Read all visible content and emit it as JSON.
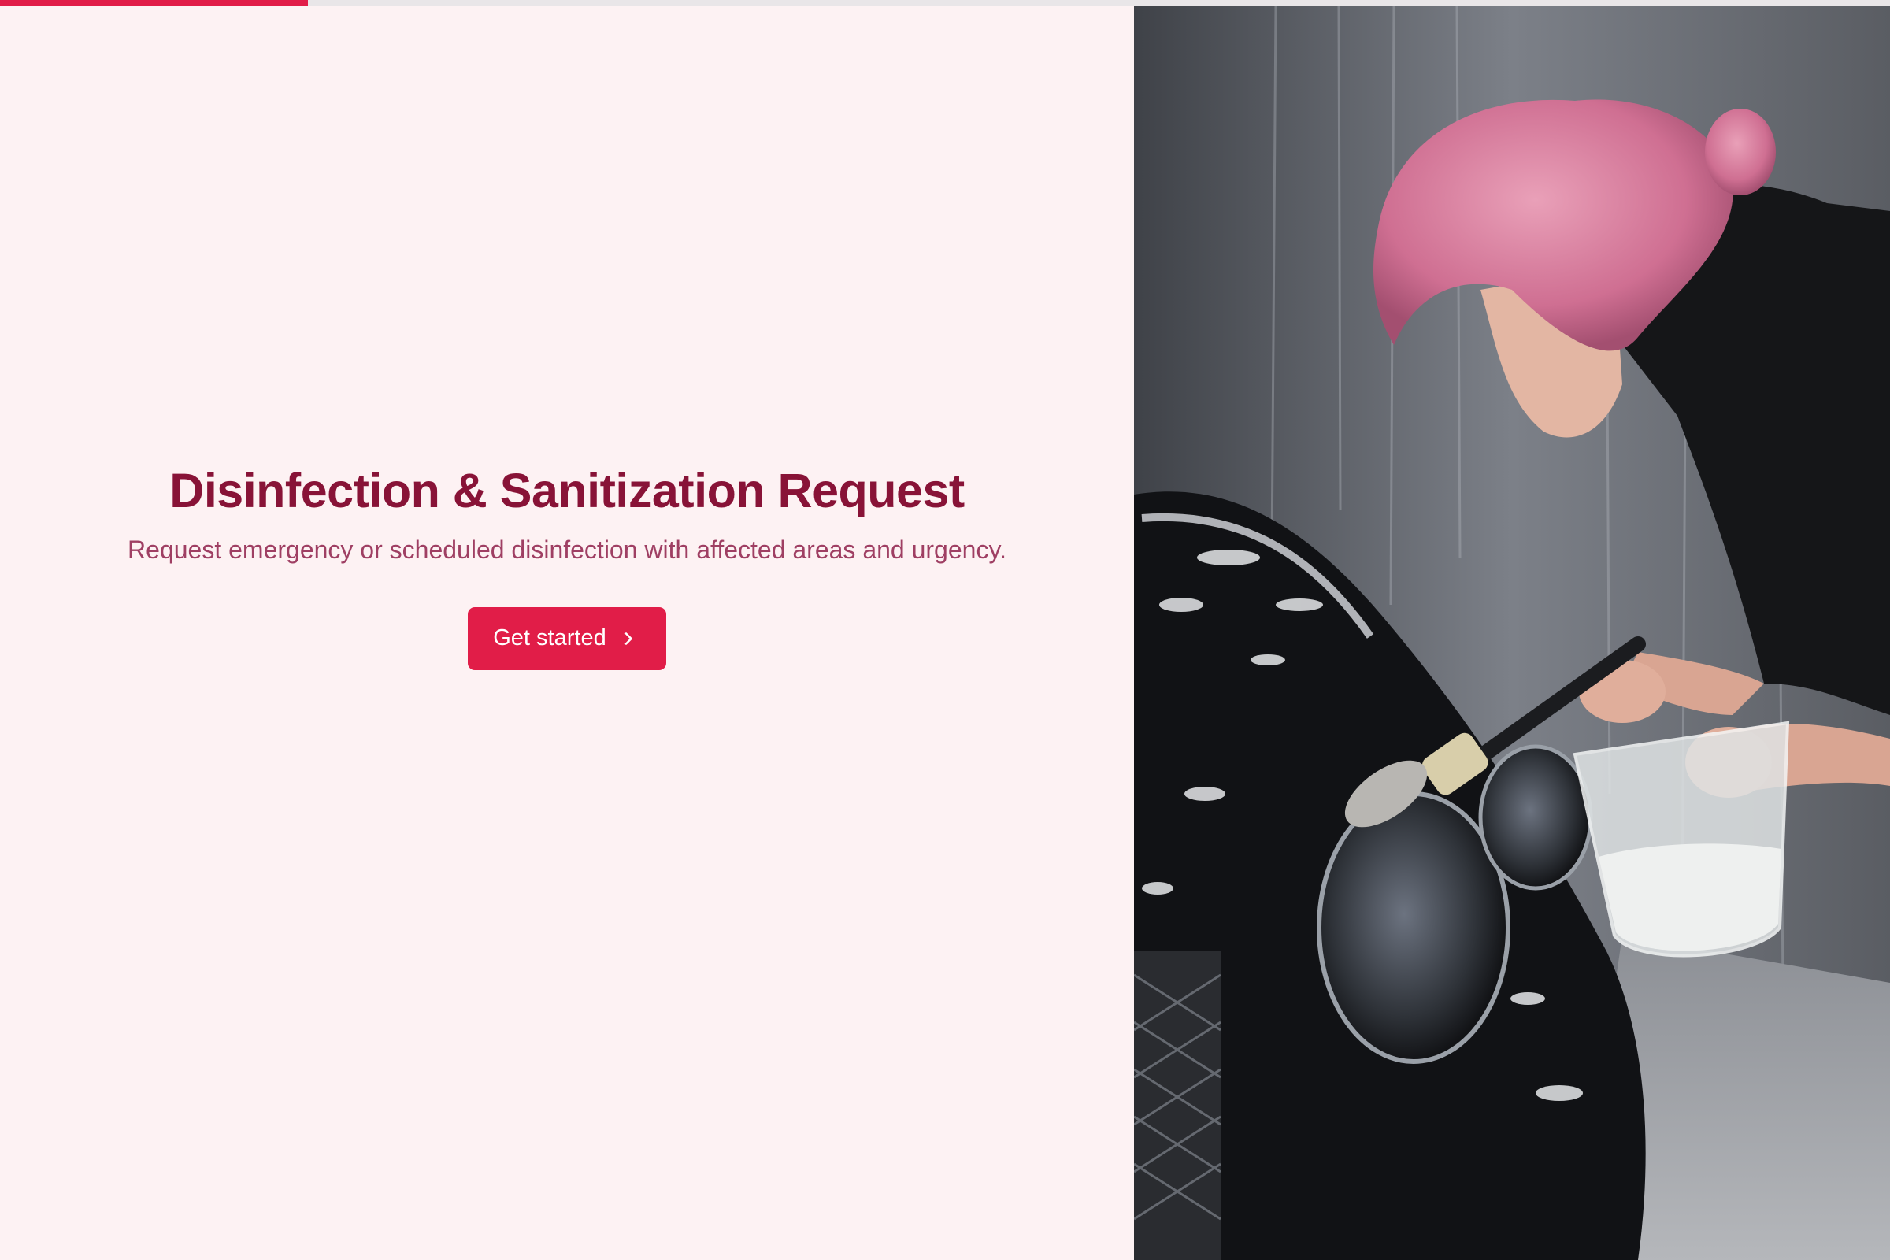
{
  "progress": {
    "fraction": 0.163,
    "color": "#e11d48"
  },
  "hero": {
    "title": "Disinfection & Sanitization Request",
    "subtitle": "Request emergency or scheduled disinfection with affected areas and urgency.",
    "cta_label": "Get started",
    "cta_icon": "chevron-right-icon"
  },
  "colors": {
    "background": "#fdf2f3",
    "title": "#881337",
    "subtitle": "#9f3f63",
    "accent": "#e11d48"
  }
}
